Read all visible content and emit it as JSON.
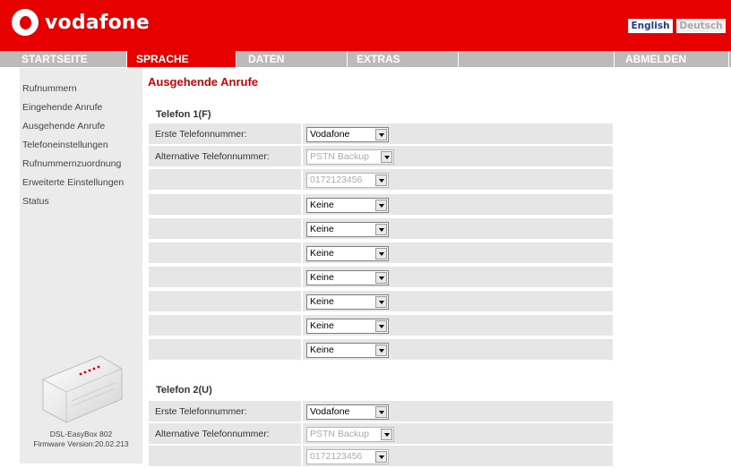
{
  "brand": {
    "name": "vodafone"
  },
  "language": {
    "english": "English",
    "deutsch": "Deutsch"
  },
  "nav": {
    "items": [
      "STARTSEITE",
      "SPRACHE",
      "DATEN",
      "EXTRAS",
      "",
      "ABMELDEN"
    ],
    "active": "SPRACHE"
  },
  "sidebar": {
    "links": [
      "Rufnummern",
      "Eingehende Anrufe",
      "Ausgehende Anrufe",
      "Telefoneinstellungen",
      "Rufnummernzuordnung",
      "Erweiterte Einstellungen",
      "Status"
    ],
    "device_name": "DSL-EasyBox 802",
    "firmware": "Firmware Version:20.02.213"
  },
  "main": {
    "title": "Ausgehende Anrufe",
    "phone1": {
      "heading": "Telefon 1(F)",
      "first_label": "Erste Telefonnummer:",
      "first_value": "Vodafone",
      "alt_label": "Alternative Telefonnummer:",
      "alt_value": "PSTN Backup",
      "alt_number": "0172123456",
      "extra_values": [
        "Keine",
        "Keine",
        "Keine",
        "Keine",
        "Keine",
        "Keine",
        "Keine"
      ]
    },
    "phone2": {
      "heading": "Telefon 2(U)",
      "first_label": "Erste Telefonnummer:",
      "first_value": "Vodafone",
      "alt_label": "Alternative Telefonnummer:",
      "alt_value": "PSTN Backup",
      "alt_number": "0172123456"
    }
  },
  "colors": {
    "brand_red": "#e60000",
    "nav_gray": "#bbbbbb",
    "row_gray": "#e6e6e6"
  }
}
